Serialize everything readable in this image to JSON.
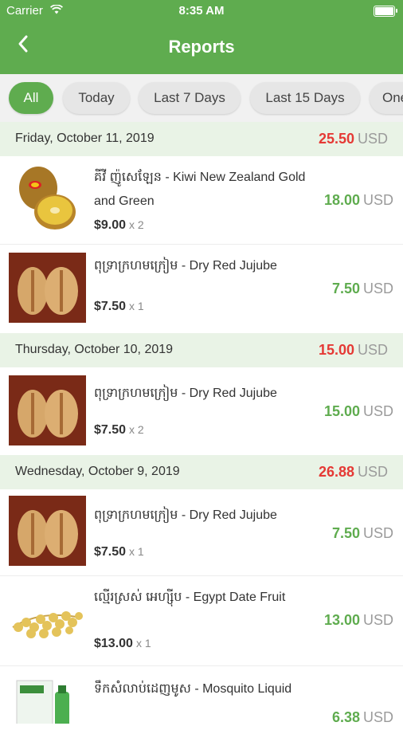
{
  "status": {
    "carrier": "Carrier",
    "time": "8:35 AM"
  },
  "header": {
    "title": "Reports",
    "back_icon": "chevron-left-icon"
  },
  "filters": [
    "All",
    "Today",
    "Last 7 Days",
    "Last 15 Days",
    "One"
  ],
  "active_filter": "All",
  "days": [
    {
      "date": "Friday, October 11, 2019",
      "total": "25.50",
      "currency": "USD",
      "items": [
        {
          "name": "គីវី ញ៉ូសេឡែន - Kiwi New Zealand Gold and Green",
          "price": "$9.00",
          "qty": "x 2",
          "total": "18.00",
          "currency": "USD",
          "image": "kiwi"
        },
        {
          "name": "ពុទ្រាក្រហមក្រៀម - Dry Red Jujube",
          "price": "$7.50",
          "qty": "x 1",
          "total": "7.50",
          "currency": "USD",
          "image": "jujube"
        }
      ]
    },
    {
      "date": "Thursday, October 10, 2019",
      "total": "15.00",
      "currency": "USD",
      "items": [
        {
          "name": "ពុទ្រាក្រហមក្រៀម - Dry Red Jujube",
          "price": "$7.50",
          "qty": "x 2",
          "total": "15.00",
          "currency": "USD",
          "image": "jujube"
        }
      ]
    },
    {
      "date": "Wednesday, October 9, 2019",
      "total": "26.88",
      "currency": "USD",
      "items": [
        {
          "name": "ពុទ្រាក្រហមក្រៀម - Dry Red Jujube",
          "price": "$7.50",
          "qty": "x 1",
          "total": "7.50",
          "currency": "USD",
          "image": "jujube"
        },
        {
          "name": "ល្មើរស្រស់ អេហ្ស៊ីប - Egypt Date Fruit",
          "price": "$13.00",
          "qty": "x 1",
          "total": "13.00",
          "currency": "USD",
          "image": "dates"
        },
        {
          "name": "ទឹកសំលាប់ដេញមូស - Mosquito Liquid",
          "price": "",
          "qty": "",
          "total": "6.38",
          "currency": "USD",
          "image": "mosquito"
        }
      ]
    }
  ]
}
